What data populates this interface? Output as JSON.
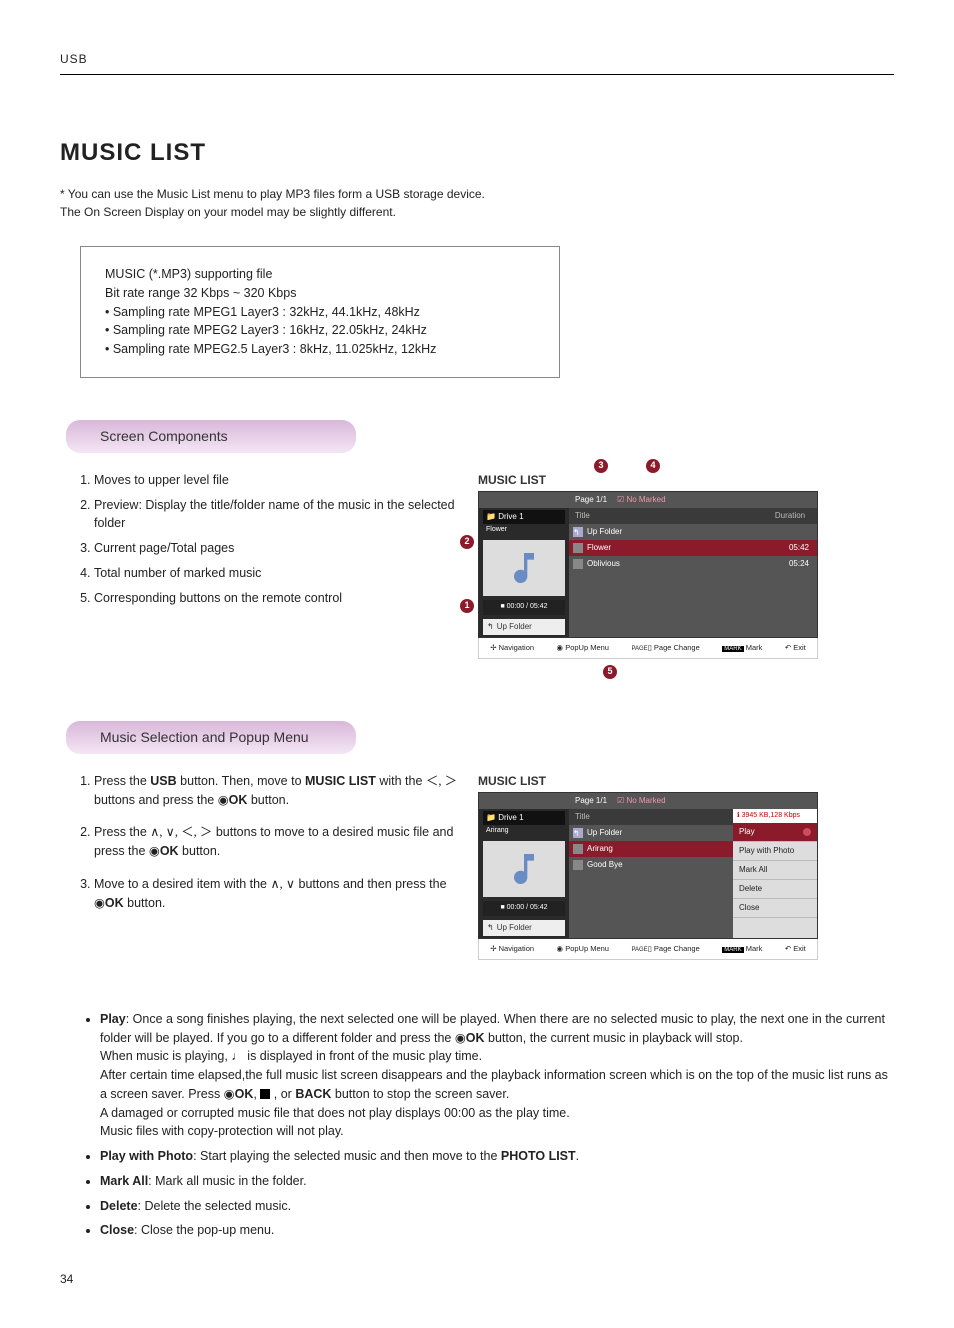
{
  "header": "USB",
  "title": "MUSIC LIST",
  "intro": "* You can use the Music List menu to play MP3 files form a USB storage device.\n  The On Screen Display on your model may be slightly different.",
  "specs": {
    "l1": "MUSIC (*.MP3) supporting file",
    "l2": "Bit rate range 32 Kbps ~ 320 Kbps",
    "b1": "• Sampling rate MPEG1 Layer3 : 32kHz, 44.1kHz, 48kHz",
    "b2": "• Sampling rate MPEG2 Layer3 : 16kHz, 22.05kHz, 24kHz",
    "b3": "• Sampling rate MPEG2.5 Layer3 : 8kHz, 11.025kHz, 12kHz"
  },
  "sec1_title": "Screen Components",
  "sec1_items": {
    "i1": "Moves to upper level file",
    "i2": "Preview: Display the title/folder name of the music in the selected folder",
    "i3": "Current page/Total pages",
    "i4": "Total number of marked music",
    "i5": "Corresponding buttons on the remote control"
  },
  "screen1": {
    "title": "MUSIC LIST",
    "page": "Page 1/1",
    "marked": "No Marked",
    "drive": "Drive 1",
    "folder_label": "Flower",
    "time": "00:00 / 05:42",
    "up_folder": "Up Folder",
    "col_title": "Title",
    "col_dur": "Duration",
    "rows": {
      "r0": {
        "title": "Up Folder",
        "dur": ""
      },
      "r1": {
        "title": "Flower",
        "dur": "05:42"
      },
      "r2": {
        "title": "Oblivious",
        "dur": "05:24"
      }
    }
  },
  "remote": {
    "nav": "Navigation",
    "popup": "PopUp Menu",
    "page": "Page Change",
    "mark": "Mark",
    "exit": "Exit"
  },
  "sec2_title": "Music Selection and Popup Menu",
  "sec2_steps": {
    "s1a": "Press the ",
    "s1b": "USB",
    "s1c": " button. Then, move to ",
    "s1d": "MUSIC LIST",
    "s1e": " with the ",
    "s1f": " buttons and press the ",
    "s1g": "OK",
    "s1h": " button.",
    "s2a": "Press the ",
    "s2b": " buttons to move to a desired music file and press the ",
    "s2c": "OK",
    "s2d": " button.",
    "s3a": "Move to a desired item with the ",
    "s3b": " buttons and then press the ",
    "s3c": "OK",
    "s3d": " button."
  },
  "screen2": {
    "title": "MUSIC LIST",
    "page": "Page 1/1",
    "marked": "No Marked",
    "drive": "Drive 1",
    "folder_label": "Arirang",
    "time": "00:00 / 05:42",
    "up_folder": "Up Folder",
    "rows": {
      "r0": {
        "title": "Up Folder"
      },
      "r1": {
        "title": "Arirang"
      },
      "r2": {
        "title": "Good Bye"
      }
    },
    "popup_info": "3945 KB,128 Kbps",
    "popup": {
      "p1": "Play",
      "p2": "Play with Photo",
      "p3": "Mark All",
      "p4": "Delete",
      "p5": "Close"
    }
  },
  "menu_desc": {
    "play_label": "Play",
    "play_text": ": Once a song finishes playing, the next selected one will be played. When there are no selected music to play, the next one in the current folder will be played. If you go to a different folder and press the ",
    "play_text2": "OK",
    "play_text3": " button, the current music in playback will stop.",
    "play_text4": "When music is playing, ",
    "play_text5": " is displayed in front of the music play time.",
    "play_text6": "After certain time elapsed,the full music list screen disappears and the playback information screen which is on the top of the music list runs as a screen saver. Press ",
    "play_text6b": "OK",
    "play_text6c": ", ",
    "play_text6d": " , or ",
    "play_text6e": "BACK",
    "play_text6f": " button to stop the screen saver.",
    "play_text7": "A damaged or corrupted music file that does not play displays 00:00 as the play time.",
    "play_text8": "Music files with copy-protection will not play.",
    "pwp_label": "Play with Photo",
    "pwp_text": ": Start playing the selected music and then move to the ",
    "pwp_text2": "PHOTO LIST",
    "pwp_text3": ".",
    "markall_label": "Mark All",
    "markall_text": ": Mark all music in the folder.",
    "delete_label": "Delete",
    "delete_text": ": Delete the selected music.",
    "close_label": "Close",
    "close_text": ": Close the pop-up menu."
  },
  "page_num": "34"
}
